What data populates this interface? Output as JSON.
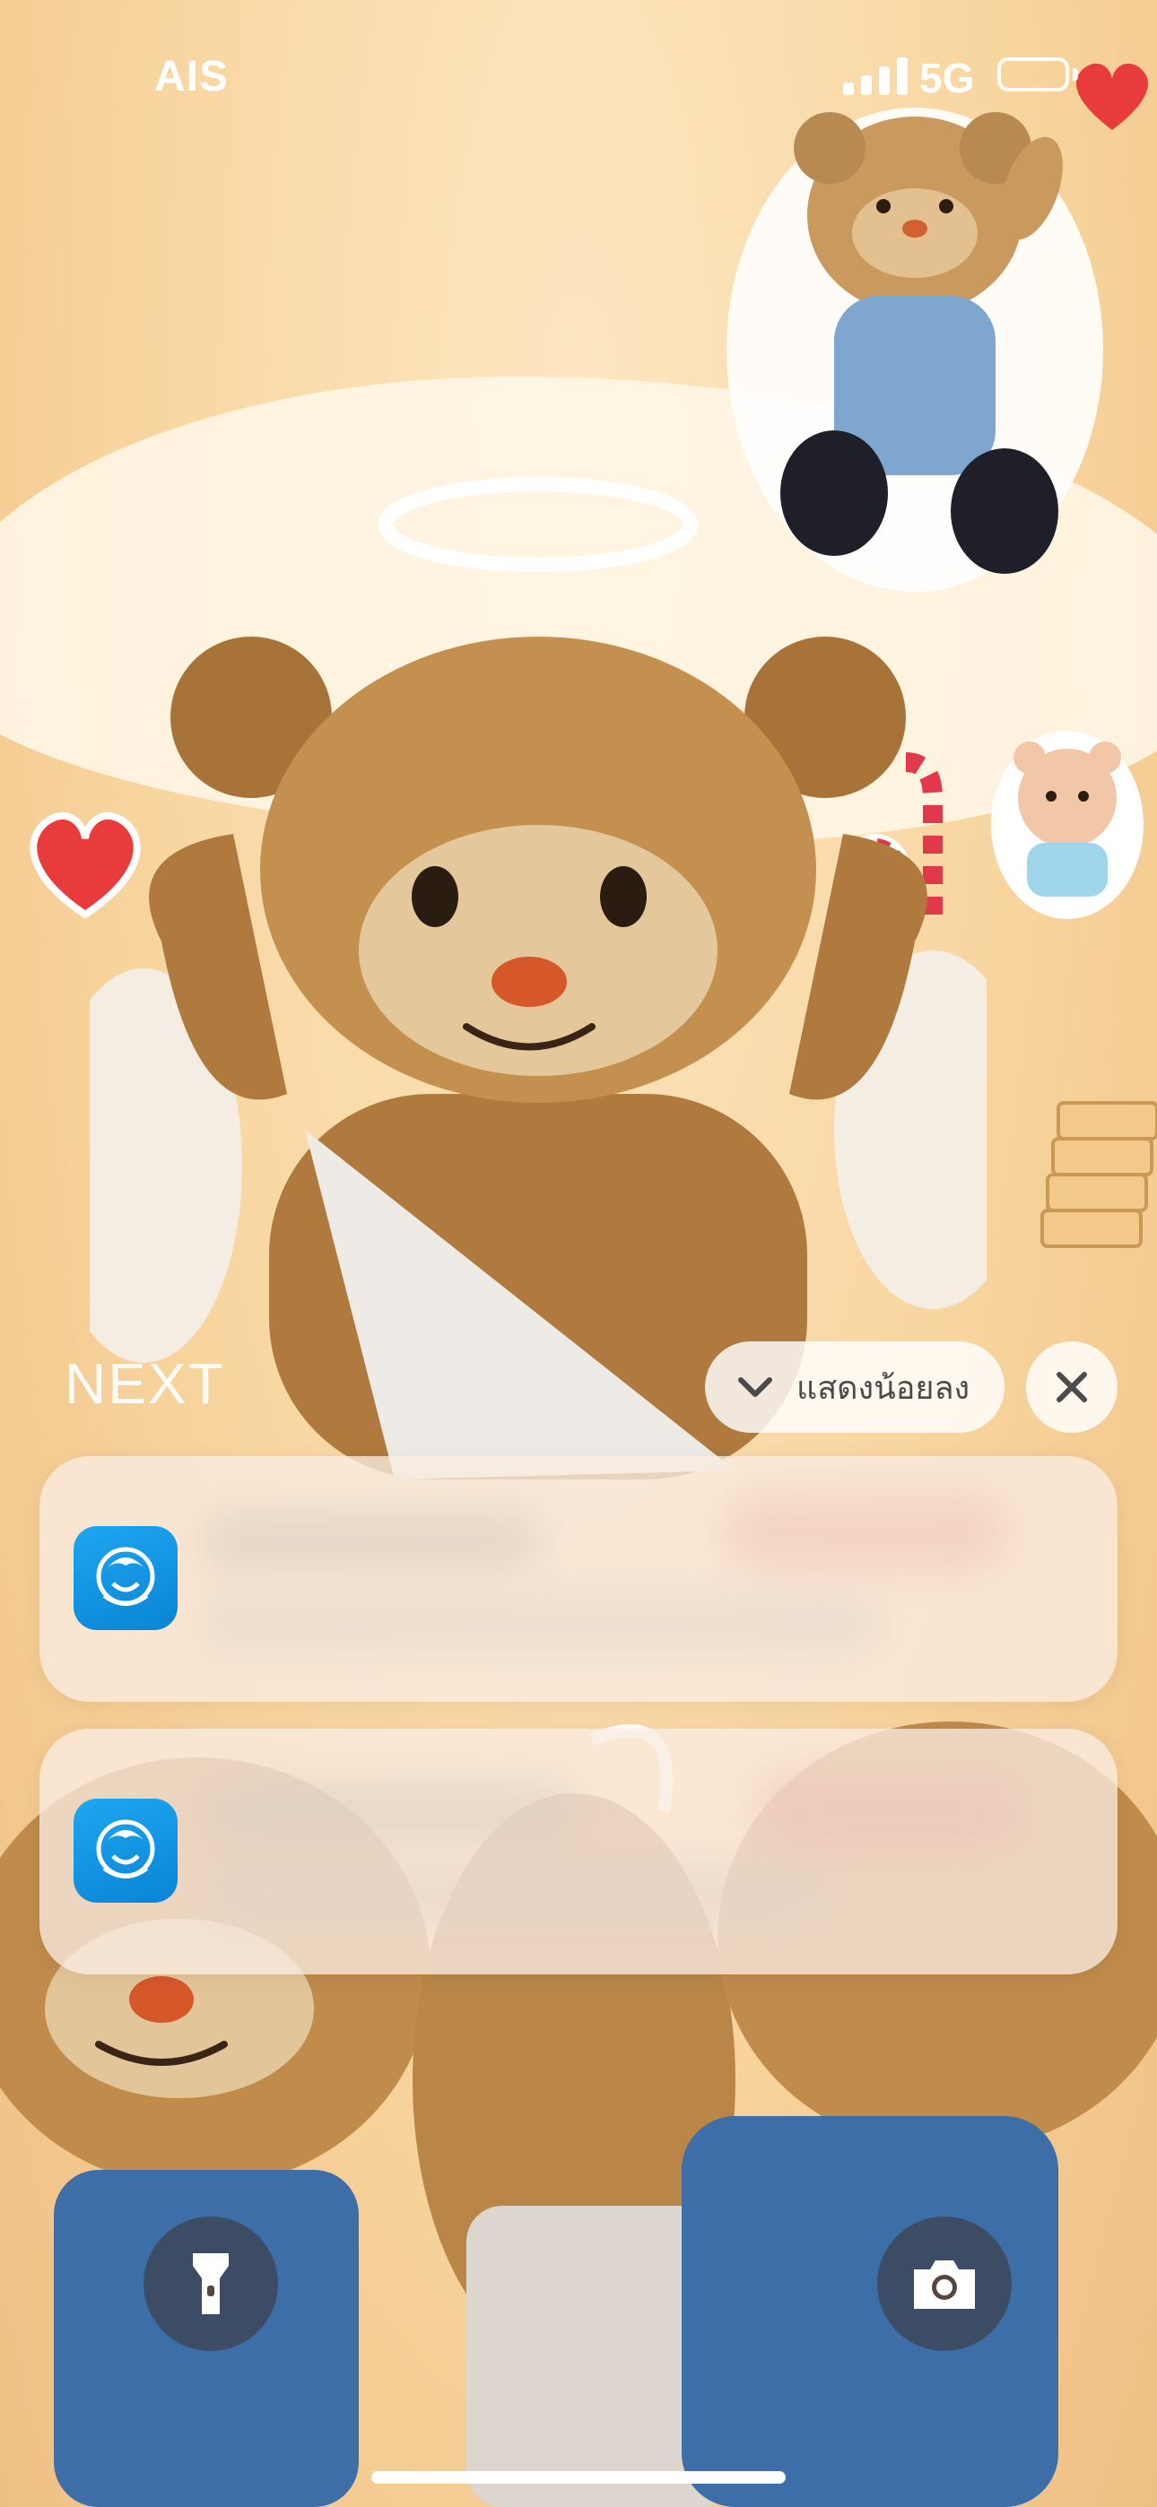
{
  "status_bar": {
    "carrier": "AIS",
    "network": "5G",
    "signal_bars": 4
  },
  "lockscreen": {
    "next_label": "NEXT",
    "show_less_label": "แสดงน้อยลง",
    "show_less_icon": "chevron-down-icon",
    "close_icon": "close-icon"
  },
  "notifications": [
    {
      "app_icon": "bank-app-icon",
      "app_color": "#1ea7f0"
    },
    {
      "app_icon": "bank-app-icon",
      "app_color": "#1ea7f0"
    }
  ],
  "bottom_controls": {
    "flashlight_icon": "flashlight-icon",
    "camera_icon": "camera-icon"
  },
  "colors": {
    "wallpaper_base": "#f8d59f",
    "notification_bg": "#faece1",
    "app_icon_blue": "#1ea7f0"
  }
}
